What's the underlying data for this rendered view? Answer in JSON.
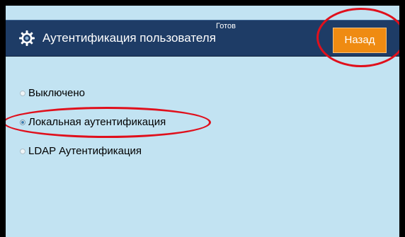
{
  "header": {
    "icon": "gear-icon",
    "title": "Аутентификация пользователя",
    "status": "Готов",
    "back_label": "Назад"
  },
  "auth_options": [
    {
      "label": "Выключено",
      "selected": false
    },
    {
      "label": "Локальная аутентификация",
      "selected": true
    },
    {
      "label": "LDAP Аутентификация",
      "selected": false
    }
  ],
  "colors": {
    "header_bg": "#1e3c66",
    "screen_bg": "#c2e3f2",
    "back_button": "#ef8b12",
    "annotation": "#e0101c"
  }
}
